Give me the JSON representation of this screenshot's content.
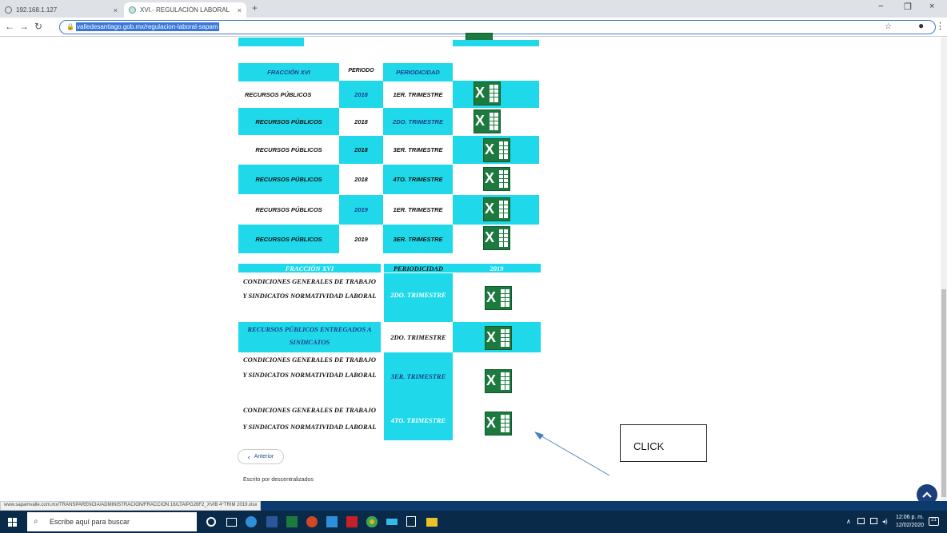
{
  "browser": {
    "tabs": [
      {
        "title": "192.168.1.127",
        "close": "×"
      },
      {
        "title": "XVI.- REGULACIÓN LABORAL",
        "close": "×"
      }
    ],
    "new_tab": "+",
    "url": "valledesantiago.gob.mx/regulacion-laboral-sapam",
    "window_controls": [
      "−",
      "❐",
      "×"
    ]
  },
  "table1": {
    "headers": {
      "fraccion": "FRACCIÓN XVI",
      "periodo": "PERIODO",
      "periodicidad": "PERIODICIDAD"
    },
    "rows": [
      {
        "concept": "RECURSOS PÚBLICOS",
        "year": "2018",
        "period": "1ER. TRIMESTRE"
      },
      {
        "concept": "RECURSOS PÚBLICOS",
        "year": "2018",
        "period": "2DO. TRIMESTRE"
      },
      {
        "concept": "RECURSOS PÚBLICOS",
        "year": "2018",
        "period": "3ER. TRIMESTRE"
      },
      {
        "concept": "RECURSOS PÚBLICOS",
        "year": "2018",
        "period": "4TO. TRIMESTRE"
      },
      {
        "concept": "RECURSOS PÚBLICOS",
        "year": "2019",
        "period": "1ER. TRIMESTRE"
      },
      {
        "concept": "RECURSOS PÚBLICOS",
        "year": "2019",
        "period": "3ER. TRIMESTRE"
      }
    ]
  },
  "table2": {
    "headers": {
      "fraccion": "FRACCIÓN XVI",
      "periodicidad": "PERIODICIDAD",
      "year": "2019"
    },
    "rows": [
      {
        "concept_line1": "CONDICIONES GENERALES DE TRABAJO",
        "concept_line2": "Y SINDICATOS NORMATIVIDAD LABORAL",
        "period": "2DO. TRIMESTRE"
      },
      {
        "concept_line1": "RECURSOS PÚBLICOS ENTREGADOS A",
        "concept_line2": "SINDICATOS",
        "period": "2DO. TRIMESTRE"
      },
      {
        "concept_line1": "CONDICIONES GENERALES DE TRABAJO",
        "concept_line2": "Y SINDICATOS NORMATIVIDAD LABORAL",
        "period": "3ER. TRIMESTRE"
      },
      {
        "concept_line1": "CONDICIONES GENERALES DE TRABAJO",
        "concept_line2": "Y SINDICATOS NORMATIVIDAD LABORAL",
        "period": "4TO. TRIMESTRE"
      }
    ]
  },
  "excel_letter": "X",
  "anterior": {
    "arrow": "‹",
    "label": "Anterior"
  },
  "escrito": "Escrito por descentralizados",
  "annotation": {
    "label": "CLICK"
  },
  "status_url": "www.sapamvalle.com.mx/TRANSPARENCIA/ADMINISTRACION/FRACCION 16/LTAIPG26F2_XVIB 4°TRIM 2019.xlsx",
  "taskbar": {
    "search_placeholder": "Escribe aquí para buscar",
    "time": "12:06 p. m.",
    "date": "12/02/2020",
    "notifications": "21"
  },
  "colors": {
    "cyan": "#1fd9ea",
    "excel_green": "#1d7a3f",
    "status_blue": "#0b3a6e",
    "taskbar": "#0a2a4a"
  }
}
